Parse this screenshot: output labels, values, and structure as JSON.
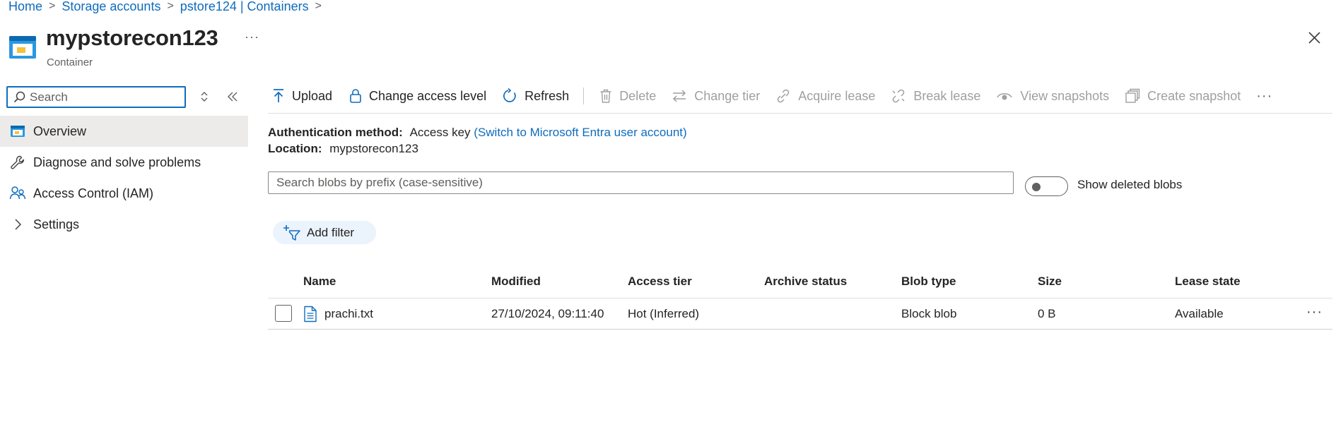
{
  "breadcrumb": {
    "items": [
      "Home",
      "Storage accounts",
      "pstore124 | Containers"
    ],
    "separator": ">"
  },
  "header": {
    "title": "mypstorecon123",
    "subtitle": "Container",
    "more": "···",
    "close": "✕"
  },
  "nav": {
    "search_placeholder": "Search",
    "items": [
      {
        "label": "Overview",
        "icon": "container-icon",
        "active": true
      },
      {
        "label": "Diagnose and solve problems",
        "icon": "wrench-icon",
        "active": false
      },
      {
        "label": "Access Control (IAM)",
        "icon": "people-icon",
        "active": false
      },
      {
        "label": "Settings",
        "icon": "chevron-right-icon",
        "active": false
      }
    ]
  },
  "toolbar": {
    "upload": "Upload",
    "change_access": "Change access level",
    "refresh": "Refresh",
    "delete": "Delete",
    "change_tier": "Change tier",
    "acquire_lease": "Acquire lease",
    "break_lease": "Break lease",
    "view_snapshots": "View snapshots",
    "create_snapshot": "Create snapshot",
    "more": "···"
  },
  "info": {
    "auth_label": "Authentication method:",
    "auth_value": "Access key",
    "auth_link": "(Switch to Microsoft Entra user account)",
    "location_label": "Location:",
    "location_value": "mypstorecon123"
  },
  "blob_search": {
    "placeholder": "Search blobs by prefix (case-sensitive)"
  },
  "show_deleted": {
    "label": "Show deleted blobs",
    "on": false
  },
  "filter": {
    "label": "Add filter"
  },
  "table": {
    "columns": [
      "Name",
      "Modified",
      "Access tier",
      "Archive status",
      "Blob type",
      "Size",
      "Lease state"
    ],
    "rows": [
      {
        "name": "prachi.txt",
        "modified": "27/10/2024, 09:11:40",
        "access_tier": "Hot (Inferred)",
        "archive_status": "",
        "blob_type": "Block blob",
        "size": "0 B",
        "lease_state": "Available",
        "more": "···"
      }
    ]
  },
  "colors": {
    "accent": "#0f6cbd",
    "disabled": "#a19f9d",
    "nav_active": "#edebe9",
    "filter_pill": "#ebf3fc"
  }
}
